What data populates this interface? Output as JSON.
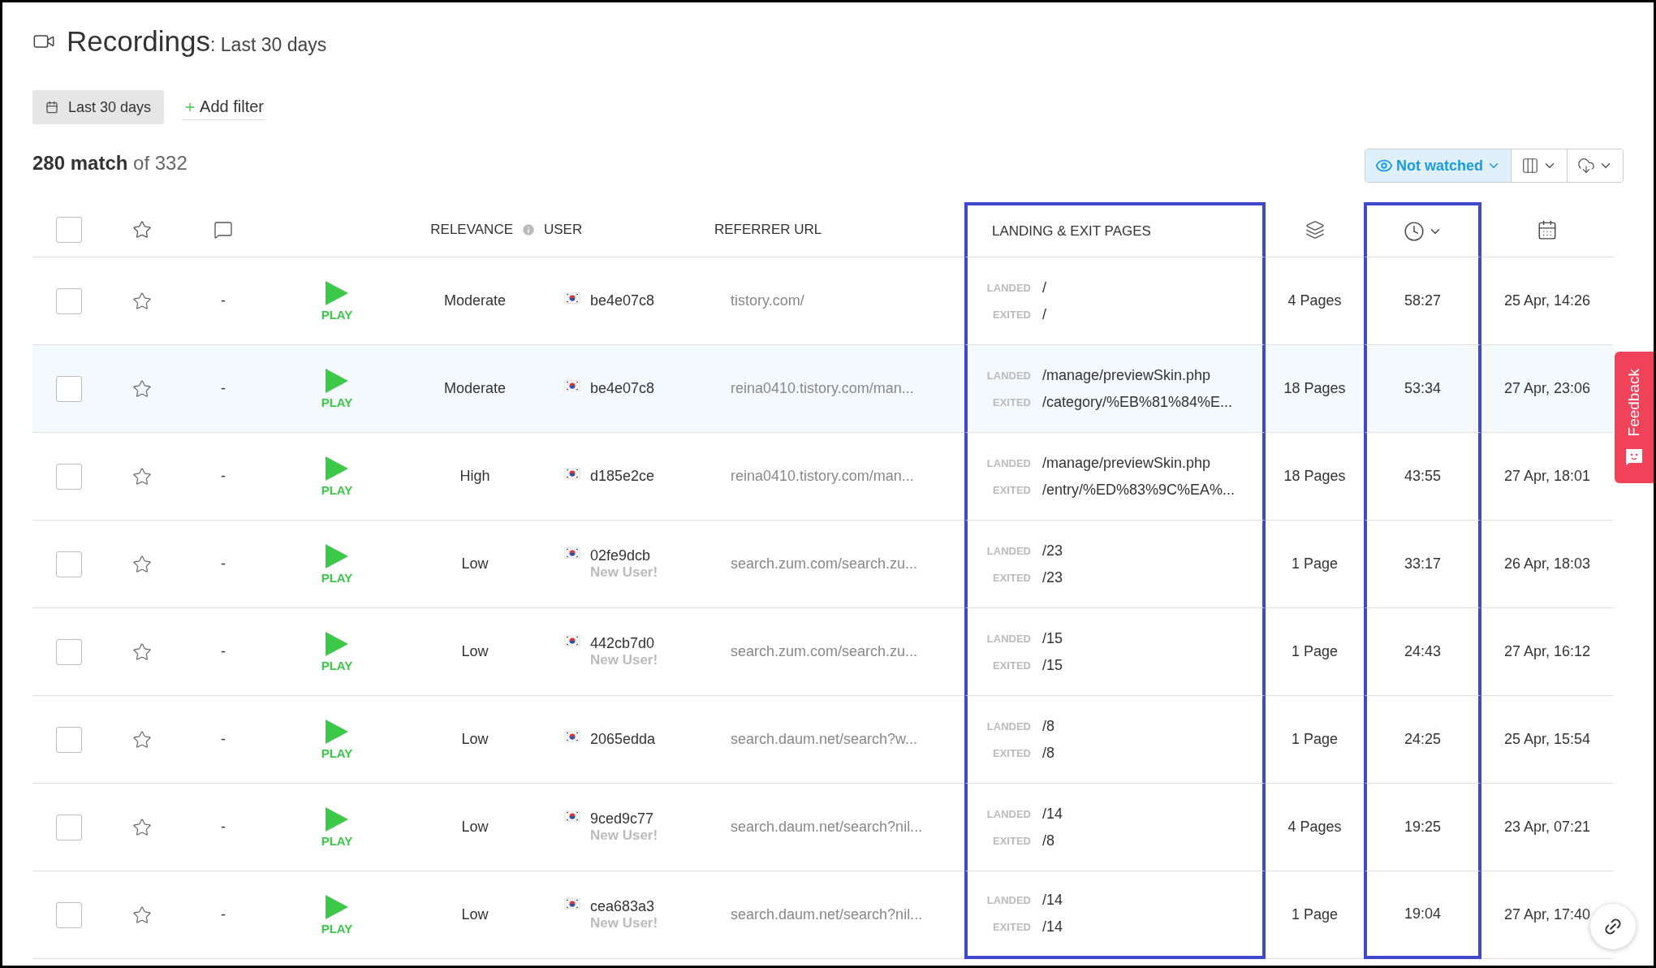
{
  "page": {
    "title": "Recordings",
    "subtitle": ": Last 30 days"
  },
  "filters": {
    "date_range": "Last 30 days",
    "add_filter": "Add filter"
  },
  "match_count": "**280 match** of 332",
  "toolbar": {
    "watch_filter": {
      "label": "Not watched",
      "active": true
    }
  },
  "columns": [
    {
      "kind": "select",
      "checked": false,
      "highlighted": false
    },
    {
      "kind": "star",
      "highlighted": false
    },
    {
      "kind": "comment",
      "highlighted": false
    },
    {
      "kind": "play",
      "highlighted": false
    },
    {
      "kind": "relevance",
      "label": "RELEVANCE",
      "highlighted": false
    },
    {
      "kind": "user",
      "label": "USER",
      "highlighted": false
    },
    {
      "kind": "referrer",
      "label": "REFERRER URL",
      "highlighted": false
    },
    {
      "kind": "pages",
      "label": "LANDING & EXIT PAGES",
      "highlighted": true
    },
    {
      "kind": "page_count",
      "highlighted": false
    },
    {
      "kind": "duration",
      "highlighted": true
    },
    {
      "kind": "date",
      "highlighted": false
    }
  ],
  "rows": [
    {
      "checked": false,
      "starred": false,
      "comment": "-",
      "action": "PLAY",
      "relevance": "Moderate",
      "user": "be4e07c8",
      "referrer": "tistory.com/",
      "landed_label": "LANDED",
      "landed": "/",
      "exited_label": "EXITED",
      "exited": "/",
      "page_count": "4 Pages",
      "duration": "58:27",
      "date": "25 Apr, 14:26",
      "highlighted": false
    },
    {
      "checked": false,
      "starred": false,
      "comment": "-",
      "action": "PLAY",
      "relevance": "Moderate",
      "user": "be4e07c8",
      "referrer": "reina0410.tistory.com/man...",
      "landed_label": "LANDED",
      "landed": "/manage/previewSkin.php",
      "exited_label": "EXITED",
      "exited": "/category/%EB%81%84%E...",
      "page_count": "18 Pages",
      "duration": "53:34",
      "date": "27 Apr, 23:06",
      "highlighted": true
    },
    {
      "checked": false,
      "starred": false,
      "comment": "-",
      "action": "PLAY",
      "relevance": "High",
      "user": "d185e2ce",
      "referrer": "reina0410.tistory.com/man...",
      "landed_label": "LANDED",
      "landed": "/manage/previewSkin.php",
      "exited_label": "EXITED",
      "exited": "/entry/%ED%83%9C%EA%...",
      "page_count": "18 Pages",
      "duration": "43:55",
      "date": "27 Apr, 18:01",
      "highlighted": false
    },
    {
      "checked": false,
      "starred": false,
      "comment": "-",
      "action": "PLAY",
      "relevance": "Low",
      "user": "02fe9dcb",
      "new_user": "New User!",
      "referrer": "search.zum.com/search.zu...",
      "landed_label": "LANDED",
      "landed": "/23",
      "exited_label": "EXITED",
      "exited": "/23",
      "page_count": "1 Page",
      "duration": "33:17",
      "date": "26 Apr, 18:03",
      "highlighted": false
    },
    {
      "checked": false,
      "starred": false,
      "comment": "-",
      "action": "PLAY",
      "relevance": "Low",
      "user": "442cb7d0",
      "new_user": "New User!",
      "referrer": "search.zum.com/search.zu...",
      "landed_label": "LANDED",
      "landed": "/15",
      "exited_label": "EXITED",
      "exited": "/15",
      "page_count": "1 Page",
      "duration": "24:43",
      "date": "27 Apr, 16:12",
      "highlighted": false
    },
    {
      "checked": false,
      "starred": false,
      "comment": "-",
      "action": "PLAY",
      "relevance": "Low",
      "user": "2065edda",
      "referrer": "search.daum.net/search?w...",
      "landed_label": "LANDED",
      "landed": "/8",
      "exited_label": "EXITED",
      "exited": "/8",
      "page_count": "1 Page",
      "duration": "24:25",
      "date": "25 Apr, 15:54",
      "highlighted": false
    },
    {
      "checked": false,
      "starred": false,
      "comment": "-",
      "action": "PLAY",
      "relevance": "Low",
      "user": "9ced9c77",
      "new_user": "New User!",
      "referrer": "search.daum.net/search?nil...",
      "landed_label": "LANDED",
      "landed": "/14",
      "exited_label": "EXITED",
      "exited": "/8",
      "page_count": "4 Pages",
      "duration": "19:25",
      "date": "23 Apr, 07:21",
      "highlighted": false
    },
    {
      "checked": false,
      "starred": false,
      "comment": "-",
      "action": "PLAY",
      "relevance": "Low",
      "user": "cea683a3",
      "new_user": "New User!",
      "referrer": "search.daum.net/search?nil...",
      "landed_label": "LANDED",
      "landed": "/14",
      "exited_label": "EXITED",
      "exited": "/14",
      "page_count": "1 Page",
      "duration": "19:04",
      "date": "27 Apr, 17:40",
      "highlighted": false
    }
  ],
  "feedback_tab": {
    "label": "Feedback"
  }
}
